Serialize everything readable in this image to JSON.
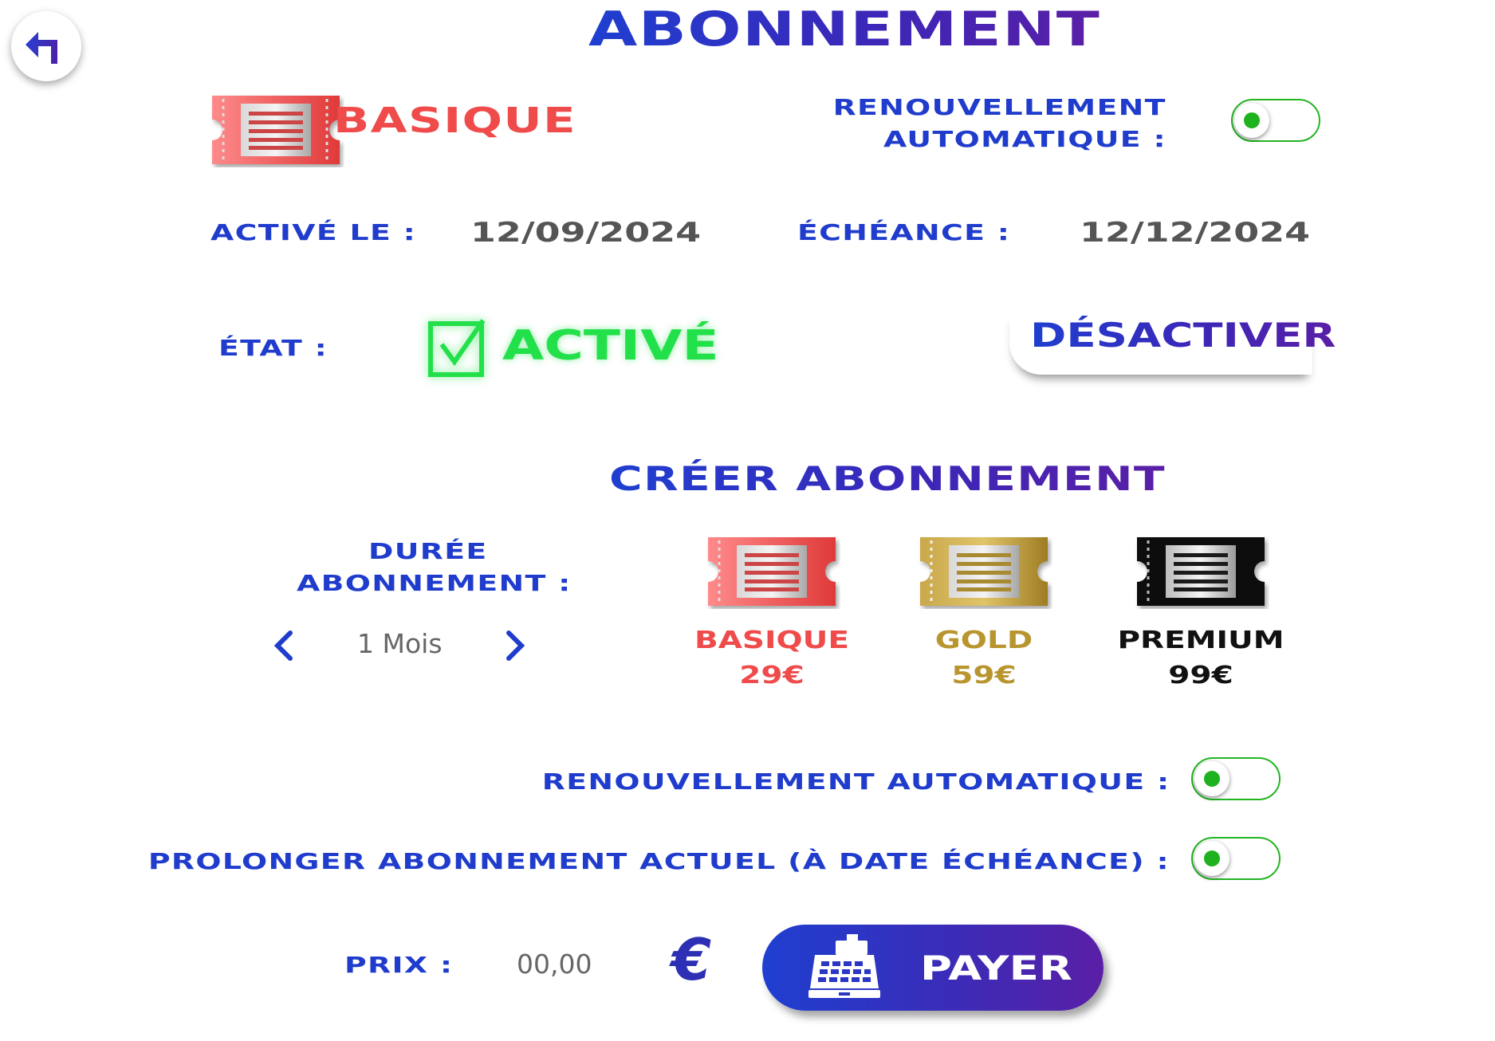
{
  "header": {
    "title": "ABONNEMENT"
  },
  "current": {
    "plan_name": "BASIQUE",
    "auto_renew_label_line1": "RENOUVELLEMENT",
    "auto_renew_label_line2": "AUTOMATIQUE :",
    "activated_label": "ACTIVÉ LE :",
    "activated_date": "12/09/2024",
    "expiry_label": "ÉCHÉANCE :",
    "expiry_date": "12/12/2024",
    "state_label": "ÉTAT :",
    "state_value": "ACTIVÉ",
    "deactivate_label": "DÉSACTIVER"
  },
  "create": {
    "title": "CRÉER ABONNEMENT",
    "duration_label_line1": "DURÉE",
    "duration_label_line2": "ABONNEMENT :",
    "duration_value": "1 Mois",
    "plans": [
      {
        "name": "BASIQUE",
        "price": "29€",
        "color": "#e85050"
      },
      {
        "name": "GOLD",
        "price": "59€",
        "color": "#b8952f"
      },
      {
        "name": "PREMIUM",
        "price": "99€",
        "color": "#111111"
      }
    ],
    "auto_renew_label": "RENOUVELLEMENT AUTOMATIQUE :",
    "extend_label": "PROLONGER ABONNEMENT ACTUEL (À DATE ÉCHÉANCE) :",
    "price_label": "PRIX :",
    "price_value": "00,00",
    "currency_symbol": "€",
    "pay_label": "PAYER"
  },
  "colors": {
    "primary": "#1f3ccc",
    "accent_purple": "#5a1fa6",
    "active_green": "#22e04a",
    "toggle_green": "#1fb21f"
  }
}
